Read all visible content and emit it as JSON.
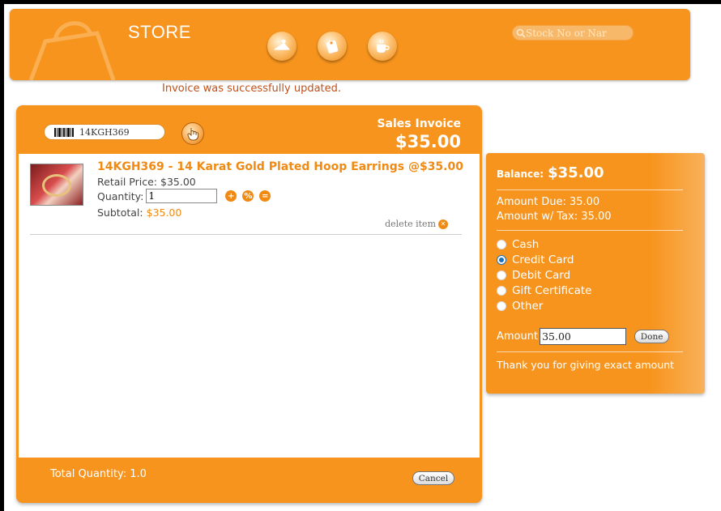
{
  "header": {
    "title": "STORE",
    "nav_icons": [
      "hanger-icon",
      "tag-icon",
      "coffee-cup-icon"
    ],
    "search_placeholder": "Stock No or Nar"
  },
  "message": "Invoice was successfully updated.",
  "invoice": {
    "barcode_value": "14KGH369",
    "title": "Sales Invoice",
    "total": "$35.00",
    "item": {
      "title": "14KGH369 - 14 Karat Gold Plated Hoop Earrings @$35.00",
      "retail_label": "Retail Price:",
      "retail_value": "$35.00",
      "quantity_label": "Quantity:",
      "quantity_value": "1",
      "subtotal_label": "Subtotal:",
      "subtotal_value": "$35.00",
      "delete_label": "delete item"
    },
    "total_quantity": "Total Quantity: 1.0",
    "cancel_label": "Cancel"
  },
  "payment": {
    "balance_label": "Balance:",
    "balance_value": "$35.00",
    "amount_due": "Amount Due: 35.00",
    "amount_tax": "Amount w/ Tax: 35.00",
    "methods": [
      "Cash",
      "Credit Card",
      "Debit Card",
      "Gift Certificate",
      "Other"
    ],
    "selected_method": "Credit Card",
    "amount_label": "Amount",
    "amount_value": "35.00",
    "done_label": "Done",
    "thanks": "Thank you for giving exact amount"
  },
  "colors": {
    "accent": "#f7941d",
    "message": "#c0501b",
    "radio_selected": "#1c6fb8"
  }
}
